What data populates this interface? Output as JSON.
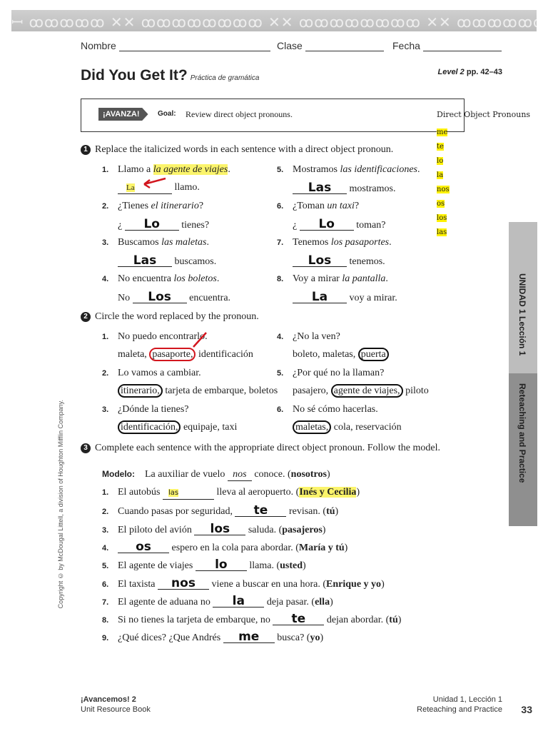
{
  "banner": {
    "pattern": "ꟷ ꝏꝏꝏꝏꝏ ✕✕ ꝏꝏꝏꝏꝏꝏꝏꝏ ✕✕ ꝏꝏꝏꝏꝏꝏꝏꝏ ✕✕ ꝏꝏꝏꝏꝏꝏꝏꝏ"
  },
  "header": {
    "nombre": "Nombre",
    "clase": "Clase",
    "fecha": "Fecha"
  },
  "title": {
    "main": "Did You Get It?",
    "sub": "Práctica de gramática",
    "level_italic": "Level 2",
    "level_pages": " pp. 42–43"
  },
  "goal": {
    "badge": "¡AVANZA!",
    "label": "Goal:",
    "text": "Review direct object pronouns."
  },
  "pronouns": {
    "title": "Direct Object Pronouns",
    "items": [
      "me",
      "te",
      "lo",
      "la",
      "nos",
      "os",
      "los",
      "las"
    ]
  },
  "section1": {
    "number": "1",
    "instruction": "Replace the italicized words in each sentence with a direct object pronoun.",
    "items": [
      {
        "n": "1.",
        "pre": "Llamo a ",
        "ital": "la agente de viajes",
        "post": ".",
        "answer": "La",
        "lead": "",
        "tail": " llamo."
      },
      {
        "n": "2.",
        "pre": "¿Tienes ",
        "ital": "el itinerario",
        "post": "?",
        "answer": "Lo",
        "lead": "¿ ",
        "tail": " tienes?"
      },
      {
        "n": "3.",
        "pre": "Buscamos ",
        "ital": "las maletas",
        "post": ".",
        "answer": "Las",
        "lead": "",
        "tail": " buscamos."
      },
      {
        "n": "4.",
        "pre": "No encuentra ",
        "ital": "los boletos",
        "post": ".",
        "answer": "Los",
        "lead": "No ",
        "tail": " encuentra."
      },
      {
        "n": "5.",
        "pre": "Mostramos ",
        "ital": "las identificaciones",
        "post": ".",
        "answer": "Las",
        "lead": "",
        "tail": " mostramos."
      },
      {
        "n": "6.",
        "pre": "¿Toman ",
        "ital": "un taxi",
        "post": "?",
        "answer": "Lo",
        "lead": "¿ ",
        "tail": " toman?"
      },
      {
        "n": "7.",
        "pre": "Tenemos ",
        "ital": "los pasaportes",
        "post": ".",
        "answer": "Los",
        "lead": "",
        "tail": " tenemos."
      },
      {
        "n": "8.",
        "pre": "Voy a mirar ",
        "ital": "la pantalla",
        "post": ".",
        "answer": "La",
        "lead": "",
        "tail": " voy a mirar."
      }
    ]
  },
  "section2": {
    "number": "2",
    "instruction": "Circle the word replaced by the pronoun.",
    "items": [
      {
        "n": "1.",
        "sentence": "No puedo encontrarlo.",
        "options": [
          "maleta,",
          "pasaporte,",
          "identificación"
        ],
        "circled": 1
      },
      {
        "n": "2.",
        "sentence": "Lo vamos a cambiar.",
        "options": [
          "itinerario,",
          "tarjeta de embarque,",
          "boletos"
        ],
        "circled": 0
      },
      {
        "n": "3.",
        "sentence": "¿Dónde la tienes?",
        "options": [
          "identificación,",
          "equipaje,",
          "taxi"
        ],
        "circled": 0
      },
      {
        "n": "4.",
        "sentence": "¿No la ven?",
        "options": [
          "boleto,",
          "maletas,",
          "puerta"
        ],
        "circled": 2
      },
      {
        "n": "5.",
        "sentence": "¿Por qué no la llaman?",
        "options": [
          "pasajero,",
          "agente de viajes,",
          "piloto"
        ],
        "circled": 1
      },
      {
        "n": "6.",
        "sentence": "No sé cómo hacerlas.",
        "options": [
          "maletas,",
          "cola,",
          "reservación"
        ],
        "circled": 0
      }
    ]
  },
  "section3": {
    "number": "3",
    "instruction": "Complete each sentence with the appropriate direct object pronoun. Follow the model.",
    "model": {
      "label": "Modelo:",
      "pre": "La auxiliar de vuelo ",
      "answer": "nos",
      "post": " conoce. (",
      "hint": "nosotros",
      "end": ")"
    },
    "items": [
      {
        "n": "1.",
        "pre": "El autobús ",
        "answer": "las",
        "post": " lleva al aeropuerto. (",
        "hint": "Inés y Cecilia",
        "end": ")"
      },
      {
        "n": "2.",
        "pre": "Cuando pasas por seguridad, ",
        "answer": "te",
        "post": " revisan. (",
        "hint": "tú",
        "end": ")"
      },
      {
        "n": "3.",
        "pre": "El piloto del avión ",
        "answer": "los",
        "post": " saluda. (",
        "hint": "pasajeros",
        "end": ")"
      },
      {
        "n": "4.",
        "pre": "",
        "answer": "os",
        "post": " espero en la cola para abordar. (",
        "hint": "María y tú",
        "end": ")"
      },
      {
        "n": "5.",
        "pre": "El agente de viajes ",
        "answer": "lo",
        "post": " llama. (",
        "hint": "usted",
        "end": ")"
      },
      {
        "n": "6.",
        "pre": "El taxista ",
        "answer": "nos",
        "post": " viene a buscar en una hora. (",
        "hint": "Enrique y yo",
        "end": ")"
      },
      {
        "n": "7.",
        "pre": "El agente de aduana no ",
        "answer": "la",
        "post": " deja pasar. (",
        "hint": "ella",
        "end": ")"
      },
      {
        "n": "8.",
        "pre": "Si no tienes la tarjeta de embarque, no ",
        "answer": "te",
        "post": " dejan abordar. (",
        "hint": "tú",
        "end": ")"
      },
      {
        "n": "9.",
        "pre": "¿Qué dices? ¿Que Andrés ",
        "answer": "me",
        "post": " busca? (",
        "hint": "yo",
        "end": ")"
      }
    ]
  },
  "side_tabs": {
    "unit": "UNIDAD 1 Lección 1",
    "section": "Reteaching and Practice"
  },
  "copyright": "Copyright © by McDougal Littell, a division of Houghton Mifflin Company.",
  "footer": {
    "book_title": "¡Avancemos! 2",
    "book_sub": "Unit Resource Book",
    "lesson": "Unidad 1, Lección 1",
    "section": "Reteaching and Practice",
    "page": "33"
  },
  "colors": {
    "highlight": "#fbf46b",
    "pronoun_highlight": "#fff200",
    "circle_red": "#d2161e",
    "tab_light": "#bdbdbd",
    "tab_dark": "#8f8f8f"
  }
}
